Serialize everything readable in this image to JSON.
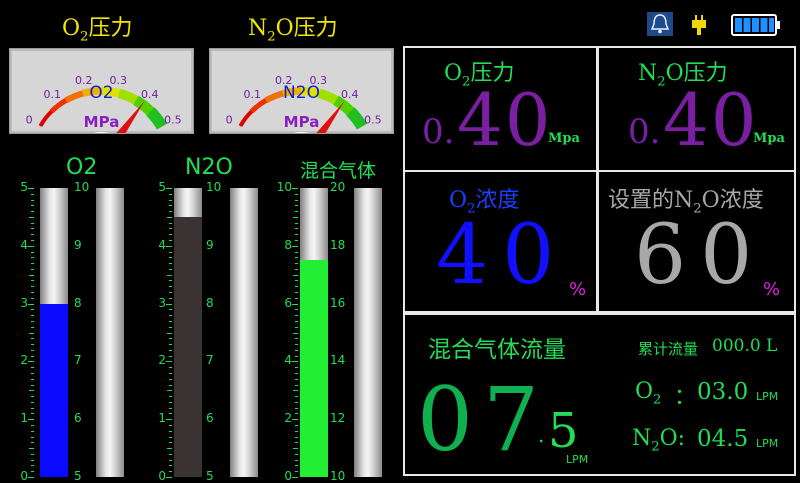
{
  "gauges": [
    {
      "title_main": "O",
      "title_sub": "2",
      "title_rest": "压力",
      "unit": "MPa",
      "center_label": "O2",
      "ticks": [
        "0",
        "0.1",
        "0.2",
        "0.3",
        "0.4",
        "0.5"
      ],
      "value": 0.4
    },
    {
      "title_main": "N",
      "title_sub": "2",
      "title_rest": "O压力",
      "unit": "MPa",
      "center_label": "N2O",
      "ticks": [
        "0",
        "0.1",
        "0.2",
        "0.3",
        "0.4",
        "0.5"
      ],
      "value": 0.4
    }
  ],
  "status_icons": [
    "bell-icon",
    "plug-icon",
    "battery-icon"
  ],
  "columns": {
    "o2_title": "O2",
    "n2o_title": "N2O",
    "mix_title": "混合气体",
    "o2_scale": [
      "5",
      "4",
      "3",
      "2",
      "1",
      "0"
    ],
    "o2_level": 3,
    "o2_max": 5,
    "o2_fill_color": "#0a0aff",
    "scale_10_5": [
      "10",
      "9",
      "8",
      "7",
      "6",
      "5"
    ],
    "n2o_scale": [
      "5",
      "4",
      "3",
      "2",
      "1",
      "0"
    ],
    "n2o_level": 4.5,
    "n2o_max": 5,
    "n2o_fill_color": "#3b3234",
    "mix_scale_left": [
      "10",
      "8",
      "6",
      "4",
      "2",
      "0"
    ],
    "mix_scale_right": [
      "20",
      "18",
      "16",
      "14",
      "12",
      "10"
    ],
    "mix_level": 7.5,
    "mix_max": 10,
    "mix_fill_color": "#22ee33"
  },
  "panels": {
    "o2_pressure": {
      "label_a": "O",
      "label_sub": "2",
      "label_b": "压力",
      "int": "0.",
      "dec": "40",
      "unit": "Mpa"
    },
    "n2o_pressure": {
      "label_a": "N",
      "label_sub": "2",
      "label_b": "O压力",
      "int": "0.",
      "dec": "40",
      "unit": "Mpa"
    },
    "o2_conc": {
      "label_a": "O",
      "label_sub": "2",
      "label_b": "浓度",
      "value": "40",
      "unit": "%"
    },
    "n2o_conc": {
      "label_a": "设置的N",
      "label_sub": "2",
      "label_b": "O浓度",
      "value": "60",
      "unit": "%"
    },
    "flow": {
      "title": "混合气体流量",
      "cumulative_label": "累计流量",
      "cumulative_value": "000.0",
      "cumulative_unit": "L",
      "int": "07",
      "dot": ".",
      "dec": "5",
      "unit": "LPM",
      "o2_label_a": "O",
      "o2_label_sub": "2",
      "o2_sep": "：",
      "o2_value": "03.0",
      "n2o_label_a": "N",
      "n2o_label_sub": "2",
      "n2o_label_b": "O:",
      "n2o_value": "04.5",
      "sub_unit": "LPM"
    }
  },
  "colors": {
    "purple": "#7a1fa2",
    "blue": "#1010ff",
    "gray": "#a8a8a8",
    "green": "#22dd55",
    "yellow": "#f2e600",
    "magenta": "#dd22dd"
  }
}
